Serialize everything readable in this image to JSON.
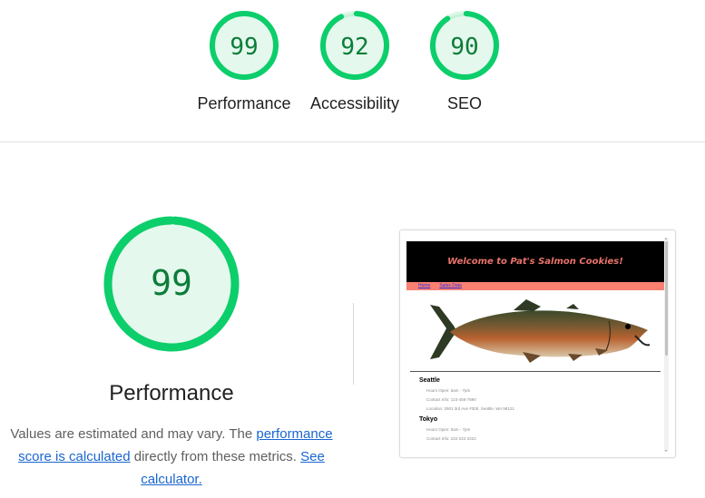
{
  "scores": [
    {
      "label": "Performance",
      "value": "99",
      "score": 0.99
    },
    {
      "label": "Accessibility",
      "value": "92",
      "score": 0.92
    },
    {
      "label": "SEO",
      "value": "90",
      "score": 0.9
    }
  ],
  "main": {
    "score": "99",
    "score_fraction": 0.99,
    "title": "Performance",
    "desc_text1": "Values are estimated and may vary. The ",
    "desc_link1": "performance score is calculated",
    "desc_text2": " directly from these metrics. ",
    "desc_link2": "See calculator."
  },
  "screenshot": {
    "header": "Welcome to Pat's Salmon Cookies!",
    "nav": [
      "Home",
      "Sales Data"
    ],
    "locations": [
      {
        "name": "Seattle",
        "lines": [
          "Hours Open: 6am - 7pm",
          "Contact Info: 123-456-7890",
          "Location: 2901 3rd Ave #300, Seattle, WA 98121"
        ]
      },
      {
        "name": "Tokyo",
        "lines": [
          "Hours Open: 6am - 7pm",
          "Contact Info: 222-222-2222"
        ]
      }
    ]
  },
  "colors": {
    "pass": "#0cce6b",
    "pass_text": "#0b7d39",
    "pass_fill": "#e5f8ed",
    "header_text": "#e8736b",
    "nav_bg": "#fa8072"
  }
}
